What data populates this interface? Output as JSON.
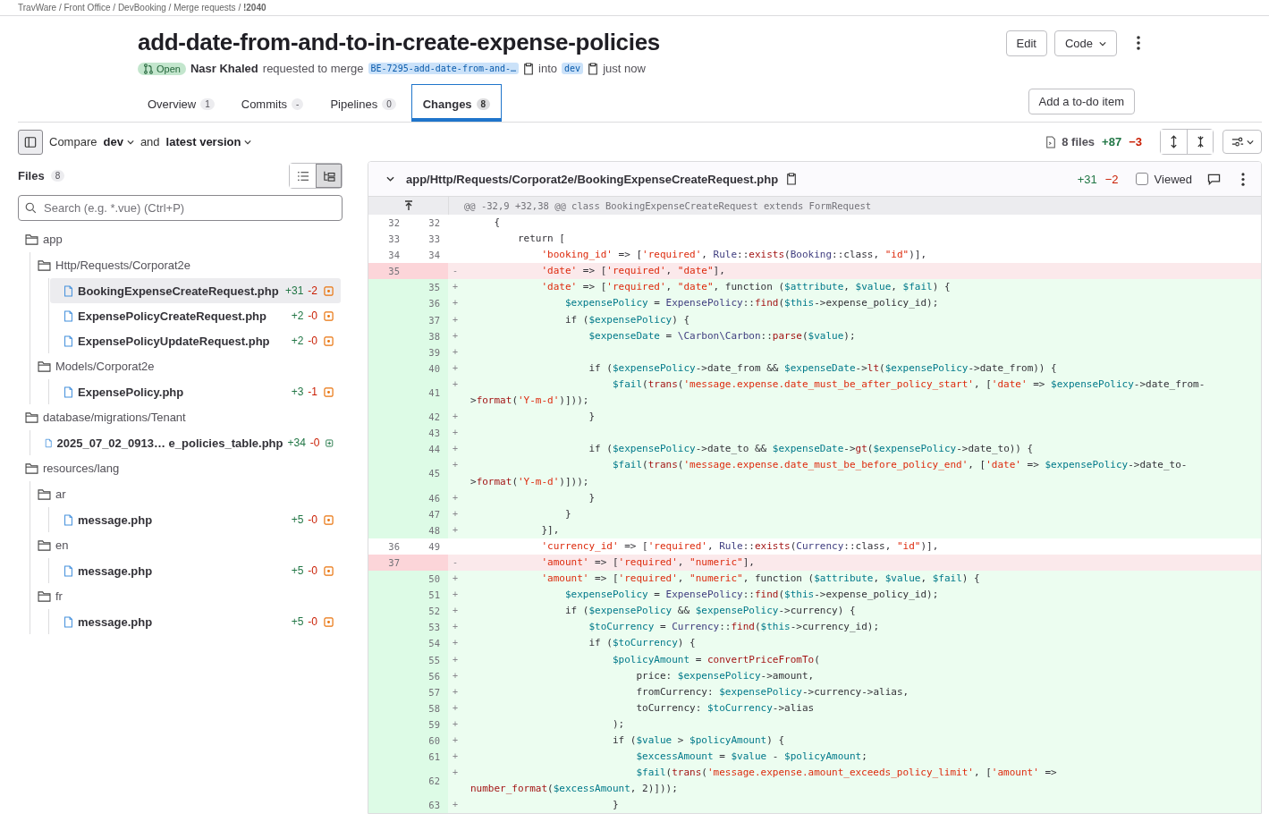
{
  "breadcrumb": "TravWare / Front Office / DevBooking / Merge requests / **!2040**",
  "title": "add-date-from-and-to-in-create-expense-policies",
  "status": {
    "label": "Open",
    "kind": "open"
  },
  "author": "Nasr Khaled",
  "action": "requested to merge",
  "source_branch": "BE-7295-add-date-from-and-…",
  "into": "into",
  "target_branch": "dev",
  "time": "just now",
  "header_buttons": [
    {
      "label": "Edit",
      "kind": "plain"
    },
    {
      "label": "Code",
      "kind": "dropdown"
    }
  ],
  "tabs": [
    {
      "label": "Overview",
      "count": "1",
      "selected": false
    },
    {
      "label": "Commits",
      "count": "-",
      "selected": false
    },
    {
      "label": "Pipelines",
      "count": "0",
      "selected": false
    },
    {
      "label": "Changes",
      "count": "8",
      "selected": true
    }
  ],
  "todo_button": "Add a to-do item",
  "compare": {
    "label": "Compare",
    "base": "dev",
    "and": "and",
    "head": "latest version"
  },
  "summary": {
    "files": "8 files",
    "added": "+87",
    "removed": "−3"
  },
  "files_panel": {
    "title": "Files",
    "count": "8",
    "search_placeholder": "Search (e.g. *.vue) (Ctrl+P)",
    "view_toggle": [
      {
        "kind": "list",
        "selected": false
      },
      {
        "kind": "tree",
        "selected": true
      }
    ]
  },
  "tree": [
    {
      "kind": "folder",
      "name": "app",
      "children": [
        {
          "kind": "folder",
          "name": "Http/Requests/Corporat2e",
          "children": [
            {
              "kind": "file",
              "name": "BookingExpenseCreateRequest.php",
              "added": "+31",
              "removed": "-2",
              "is_new": false,
              "selected": true
            },
            {
              "kind": "file",
              "name": "ExpensePolicyCreateRequest.php",
              "added": "+2",
              "removed": "-0",
              "is_new": false,
              "selected": false
            },
            {
              "kind": "file",
              "name": "ExpensePolicyUpdateRequest.php",
              "added": "+2",
              "removed": "-0",
              "is_new": false,
              "selected": false
            }
          ]
        },
        {
          "kind": "folder",
          "name": "Models/Corporat2e",
          "children": [
            {
              "kind": "file",
              "name": "ExpensePolicy.php",
              "added": "+3",
              "removed": "-1",
              "is_new": false,
              "selected": false
            }
          ]
        }
      ]
    },
    {
      "kind": "folder",
      "name": "database/migrations/Tenant",
      "children": [
        {
          "kind": "file",
          "name": "2025_07_02_0913… e_policies_table.php",
          "added": "+34",
          "removed": "-0",
          "is_new": true,
          "selected": false
        }
      ]
    },
    {
      "kind": "folder",
      "name": "resources/lang",
      "children": [
        {
          "kind": "folder",
          "name": "ar",
          "children": [
            {
              "kind": "file",
              "name": "message.php",
              "added": "+5",
              "removed": "-0",
              "is_new": false,
              "selected": false
            }
          ]
        },
        {
          "kind": "folder",
          "name": "en",
          "children": [
            {
              "kind": "file",
              "name": "message.php",
              "added": "+5",
              "removed": "-0",
              "is_new": false,
              "selected": false
            }
          ]
        },
        {
          "kind": "folder",
          "name": "fr",
          "children": [
            {
              "kind": "file",
              "name": "message.php",
              "added": "+5",
              "removed": "-0",
              "is_new": false,
              "selected": false
            }
          ]
        }
      ]
    }
  ],
  "diff": {
    "path": "app/Http/Requests/Corporat2e/BookingExpenseCreateRequest.php",
    "added": "+31",
    "removed": "−2",
    "viewed_label": "Viewed",
    "viewed": false,
    "hunk": "@@ -32,9 +32,38 @@ class BookingExpenseCreateRequest extends FormRequest",
    "lines": [
      {
        "kind": "context",
        "old": "32",
        "new": "32",
        "text": "    {"
      },
      {
        "kind": "context",
        "old": "33",
        "new": "33",
        "text": "        return ["
      },
      {
        "kind": "context",
        "old": "34",
        "new": "34",
        "text": "            'booking_id' => ['required', Rule::exists(Booking::class, \"id\")],"
      },
      {
        "kind": "del",
        "old": "35",
        "marker": "-",
        "text": "            'date' => ['required', \"date\"],"
      },
      {
        "kind": "add",
        "new": "35",
        "marker": "+",
        "text": "            'date' => ['required', \"date\", function ($attribute, $value, $fail) {"
      },
      {
        "kind": "add",
        "new": "36",
        "marker": "+",
        "text": "                $expensePolicy = ExpensePolicy::find($this->expense_policy_id);"
      },
      {
        "kind": "add",
        "new": "37",
        "marker": "+",
        "text": "                if ($expensePolicy) {"
      },
      {
        "kind": "add",
        "new": "38",
        "marker": "+",
        "text": "                    $expenseDate = \\Carbon\\Carbon::parse($value);"
      },
      {
        "kind": "add",
        "new": "39",
        "marker": "+"
      },
      {
        "kind": "add",
        "new": "40",
        "marker": "+",
        "text": "                    if ($expensePolicy->date_from && $expenseDate->lt($expensePolicy->date_from)) {"
      },
      {
        "kind": "add",
        "new": "41",
        "marker": "+",
        "text": "                        $fail(trans('message.expense.date_must_be_after_policy_start', ['date' => $expensePolicy->date_from->format('Y-m-d')]));"
      },
      {
        "kind": "add",
        "new": "42",
        "marker": "+",
        "text": "                    }"
      },
      {
        "kind": "add",
        "new": "43",
        "marker": "+"
      },
      {
        "kind": "add",
        "new": "44",
        "marker": "+",
        "text": "                    if ($expensePolicy->date_to && $expenseDate->gt($expensePolicy->date_to)) {"
      },
      {
        "kind": "add",
        "new": "45",
        "marker": "+",
        "text": "                        $fail(trans('message.expense.date_must_be_before_policy_end', ['date' => $expensePolicy->date_to->format('Y-m-d')]));"
      },
      {
        "kind": "add",
        "new": "46",
        "marker": "+",
        "text": "                    }"
      },
      {
        "kind": "add",
        "new": "47",
        "marker": "+",
        "text": "                }"
      },
      {
        "kind": "add",
        "new": "48",
        "marker": "+",
        "text": "            }],"
      },
      {
        "kind": "context",
        "old": "36",
        "new": "49",
        "text": "            'currency_id' => ['required', Rule::exists(Currency::class, \"id\")],"
      },
      {
        "kind": "del",
        "old": "37",
        "marker": "-",
        "text": "            'amount' => ['required', \"numeric\"],"
      },
      {
        "kind": "add",
        "new": "50",
        "marker": "+",
        "text": "            'amount' => ['required', \"numeric\", function ($attribute, $value, $fail) {"
      },
      {
        "kind": "add",
        "new": "51",
        "marker": "+",
        "text": "                $expensePolicy = ExpensePolicy::find($this->expense_policy_id);"
      },
      {
        "kind": "add",
        "new": "52",
        "marker": "+",
        "text": "                if ($expensePolicy && $expensePolicy->currency) {"
      },
      {
        "kind": "add",
        "new": "53",
        "marker": "+",
        "text": "                    $toCurrency = Currency::find($this->currency_id);"
      },
      {
        "kind": "add",
        "new": "54",
        "marker": "+",
        "text": "                    if ($toCurrency) {"
      },
      {
        "kind": "add",
        "new": "55",
        "marker": "+",
        "text": "                        $policyAmount = convertPriceFromTo("
      },
      {
        "kind": "add",
        "new": "56",
        "marker": "+",
        "text": "                            price: $expensePolicy->amount,"
      },
      {
        "kind": "add",
        "new": "57",
        "marker": "+",
        "text": "                            fromCurrency: $expensePolicy->currency->alias,"
      },
      {
        "kind": "add",
        "new": "58",
        "marker": "+",
        "text": "                            toCurrency: $toCurrency->alias"
      },
      {
        "kind": "add",
        "new": "59",
        "marker": "+",
        "text": "                        );"
      },
      {
        "kind": "add",
        "new": "60",
        "marker": "+",
        "text": "                        if ($value > $policyAmount) {"
      },
      {
        "kind": "add",
        "new": "61",
        "marker": "+",
        "text": "                            $excessAmount = $value - $policyAmount;"
      },
      {
        "kind": "add",
        "new": "62",
        "marker": "+",
        "text": "                            $fail(trans('message.expense.amount_exceeds_policy_limit', ['amount' => number_format($excessAmount, 2)]));"
      },
      {
        "kind": "add",
        "new": "63",
        "marker": "+",
        "text": "                        }"
      }
    ]
  }
}
